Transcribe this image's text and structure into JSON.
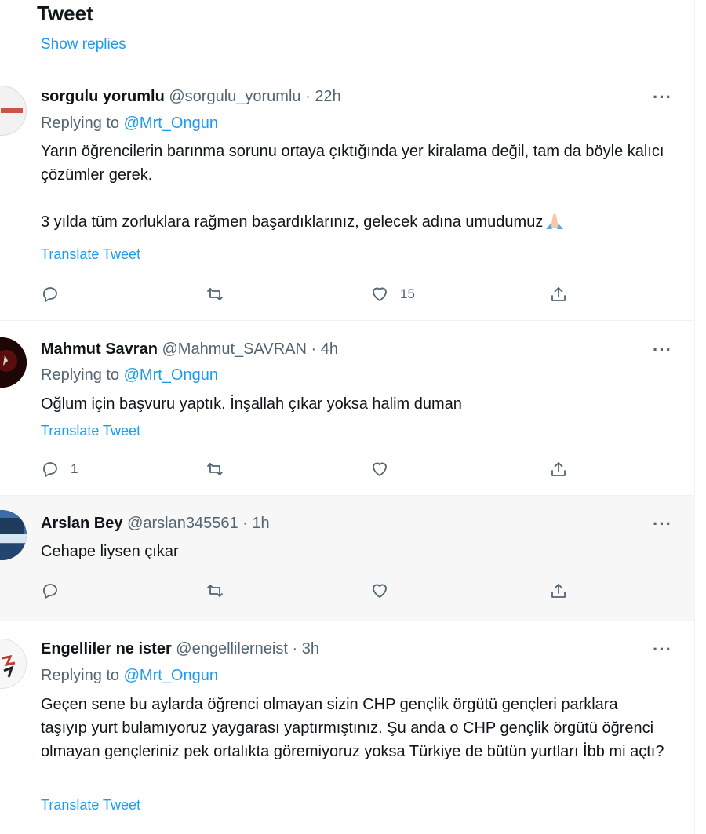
{
  "header": {
    "title": "Tweet",
    "show_replies": "Show replies"
  },
  "colors": {
    "accent": "#1d9bf0",
    "secondary_text": "#536471",
    "divider": "#eff3f4",
    "hover_bg": "#f7f7f7"
  },
  "tweets": [
    {
      "name": "sorgulu yorumlu",
      "handle": "@sorgulu_yorumlu",
      "separator": "·",
      "time": "22h",
      "replying_prefix": "Replying to",
      "replying_to": "@Mrt_Ongun",
      "text": "Yarın öğrencilerin barınma sorunu ortaya çıktığında yer kiralama değil, tam da böyle kalıcı çözümler gerek.\n\n3 yılda tüm zorluklara rağmen başardıklarınız, gelecek adına umudumuz",
      "emoji": "folded-hands-emoji",
      "translate": "Translate Tweet",
      "reply_count": "",
      "retweet_count": "",
      "like_count": "15",
      "more": "···"
    },
    {
      "name": "Mahmut Savran",
      "handle": "@Mahmut_SAVRAN",
      "separator": "·",
      "time": "4h",
      "replying_prefix": "Replying to",
      "replying_to": "@Mrt_Ongun",
      "text": "Oğlum için başvuru yaptık. İnşallah çıkar yoksa halim duman",
      "translate": "Translate Tweet",
      "reply_count": "1",
      "retweet_count": "",
      "like_count": "",
      "more": "···"
    },
    {
      "name": "Arslan Bey",
      "handle": "@arslan345561",
      "separator": "·",
      "time": "1h",
      "text": "Cehape liysen çıkar",
      "reply_count": "",
      "retweet_count": "",
      "like_count": "",
      "more": "···"
    },
    {
      "name": "Engelliler ne ister",
      "handle": "@engellilerneist",
      "separator": "·",
      "time": "3h",
      "replying_prefix": "Replying to",
      "replying_to": "@Mrt_Ongun",
      "text": "Geçen sene bu aylarda öğrenci olmayan sizin CHP gençlik örgütü gençleri parklara taşıyıp yurt bulamıyoruz yaygarası yaptırmıştınız. Şu anda o CHP gençlik örgütü öğrenci olmayan gençleriniz pek ortalıkta göremiyoruz yoksa Türkiye de bütün yurtları İbb mi açtı?",
      "translate": "Translate Tweet",
      "more": "···"
    }
  ],
  "icons": {
    "reply": "reply-icon",
    "retweet": "retweet-icon",
    "like": "heart-icon",
    "share": "share-icon",
    "more": "more-icon"
  }
}
